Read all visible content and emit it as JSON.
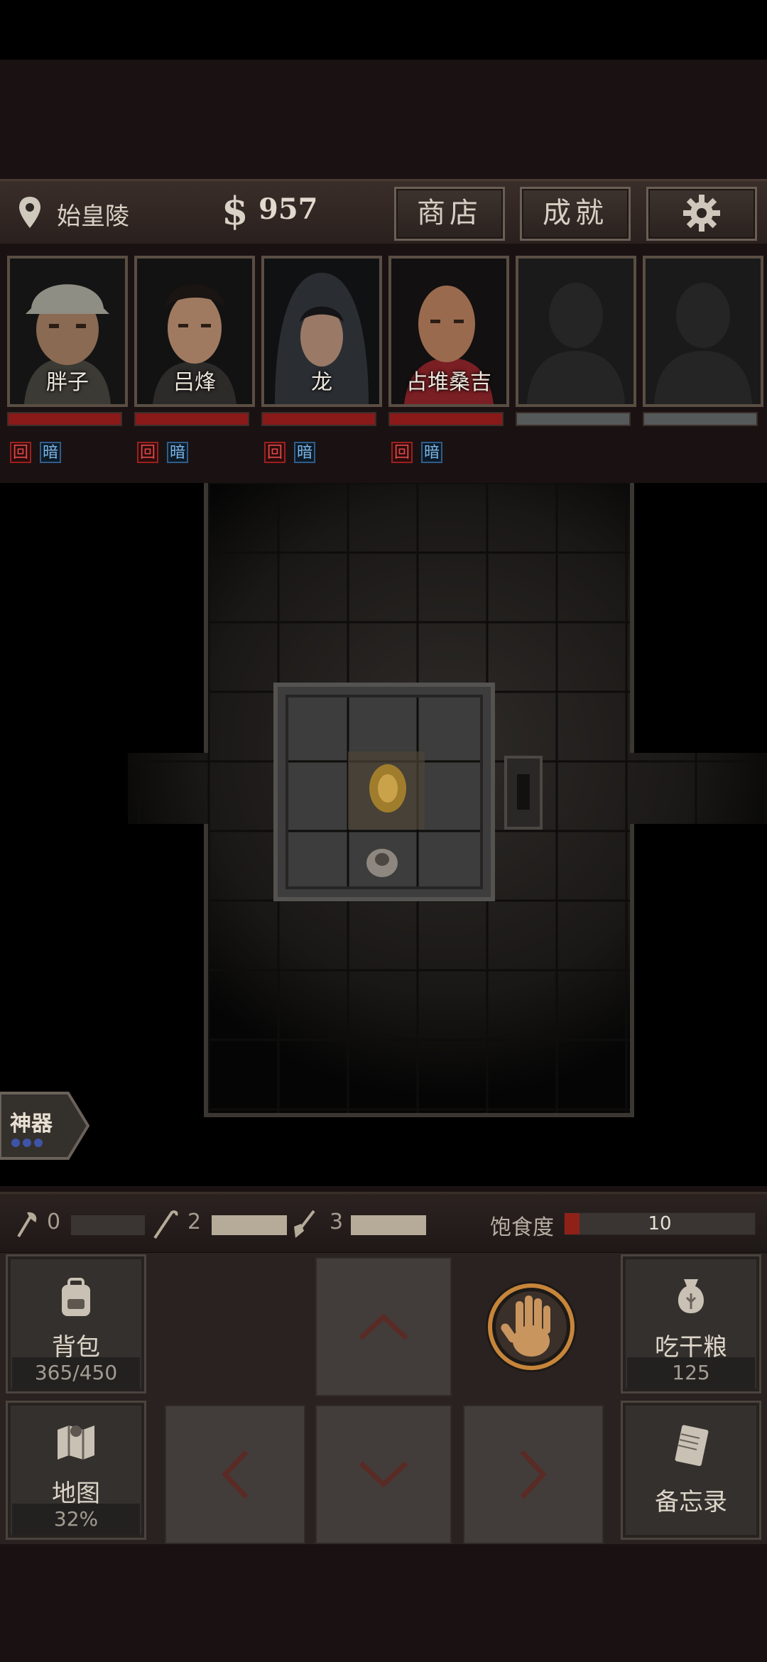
{
  "topbar": {
    "location": "始皇陵",
    "money_symbol": "$",
    "money": "957",
    "shop_label": "商店",
    "achievements_label": "成就",
    "settings_icon": "gear-icon"
  },
  "party": [
    {
      "name": "胖子",
      "tags": [
        "回",
        "暗"
      ],
      "hp_percent": 100
    },
    {
      "name": "吕烽",
      "tags": [
        "回",
        "暗"
      ],
      "hp_percent": 100
    },
    {
      "name": "龙",
      "tags": [
        "回",
        "暗"
      ],
      "hp_percent": 100
    },
    {
      "name": "占堆桑吉",
      "tags": [
        "回",
        "暗"
      ],
      "hp_percent": 100
    },
    {
      "name": "",
      "tags": [],
      "hp_percent": 0
    },
    {
      "name": "",
      "tags": [],
      "hp_percent": 0
    }
  ],
  "artifact_tab": {
    "label": "神器"
  },
  "resources": {
    "axe": "0",
    "axe_fill": 0,
    "pick": "2",
    "pick_fill": 1,
    "shovel": "3",
    "shovel_fill": 1,
    "hunger_label": "饱食度",
    "hunger_value": "10",
    "hunger_fill": 0.08
  },
  "controls": {
    "backpack_label": "背包",
    "backpack_capacity": "365/450",
    "eat_label": "吃干粮",
    "eat_count": "125",
    "map_label": "地图",
    "map_percent": "32%",
    "memo_label": "备忘录"
  },
  "colors": {
    "hp": "#8a1a1a",
    "accent": "#c7853a",
    "hunger": "#8f2119"
  }
}
